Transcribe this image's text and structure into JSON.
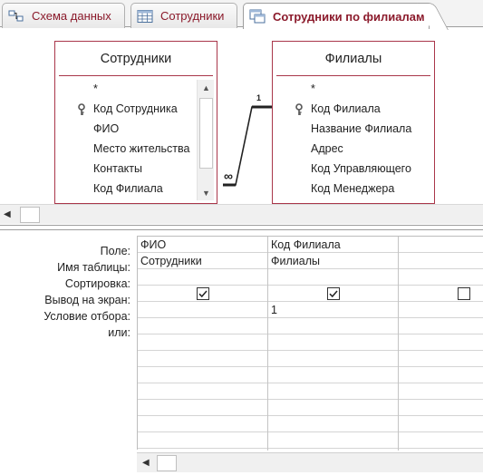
{
  "tabs": [
    {
      "label": "Схема данных",
      "icon": "relationships-icon",
      "active": false
    },
    {
      "label": "Сотрудники",
      "icon": "table-icon",
      "active": false
    },
    {
      "label": "Сотрудники по филиалам",
      "icon": "query-icon",
      "active": true
    }
  ],
  "tables": [
    {
      "title": "Сотрудники",
      "fields": [
        "*",
        "Код Сотрудника",
        "ФИО",
        "Место жительства",
        "Контакты",
        "Код Филиала"
      ],
      "key_field_index": 1,
      "has_scrollbar": true
    },
    {
      "title": "Филиалы",
      "fields": [
        "*",
        "Код Филиала",
        "Название Филиала",
        "Адрес",
        "Код Управляющего",
        "Код Менеджера"
      ],
      "key_field_index": 1,
      "has_scrollbar": false
    }
  ],
  "relationship": {
    "one_label": "1",
    "many_label": "∞"
  },
  "grid": {
    "row_labels": {
      "field": "Поле:",
      "table": "Имя таблицы:",
      "sort": "Сортировка:",
      "show": "Вывод на экран:",
      "criteria": "Условие отбора:",
      "or": "или:"
    },
    "columns": [
      {
        "field": "ФИО",
        "table": "Сотрудники",
        "sort": "",
        "show": true,
        "criteria": ""
      },
      {
        "field": "Код Филиала",
        "table": "Филиалы",
        "sort": "",
        "show": true,
        "criteria": "1"
      },
      {
        "field": "",
        "table": "",
        "sort": "",
        "show": false,
        "criteria": ""
      }
    ]
  },
  "colors": {
    "accent": "#8b1a2b",
    "table_border": "#a9364a"
  }
}
